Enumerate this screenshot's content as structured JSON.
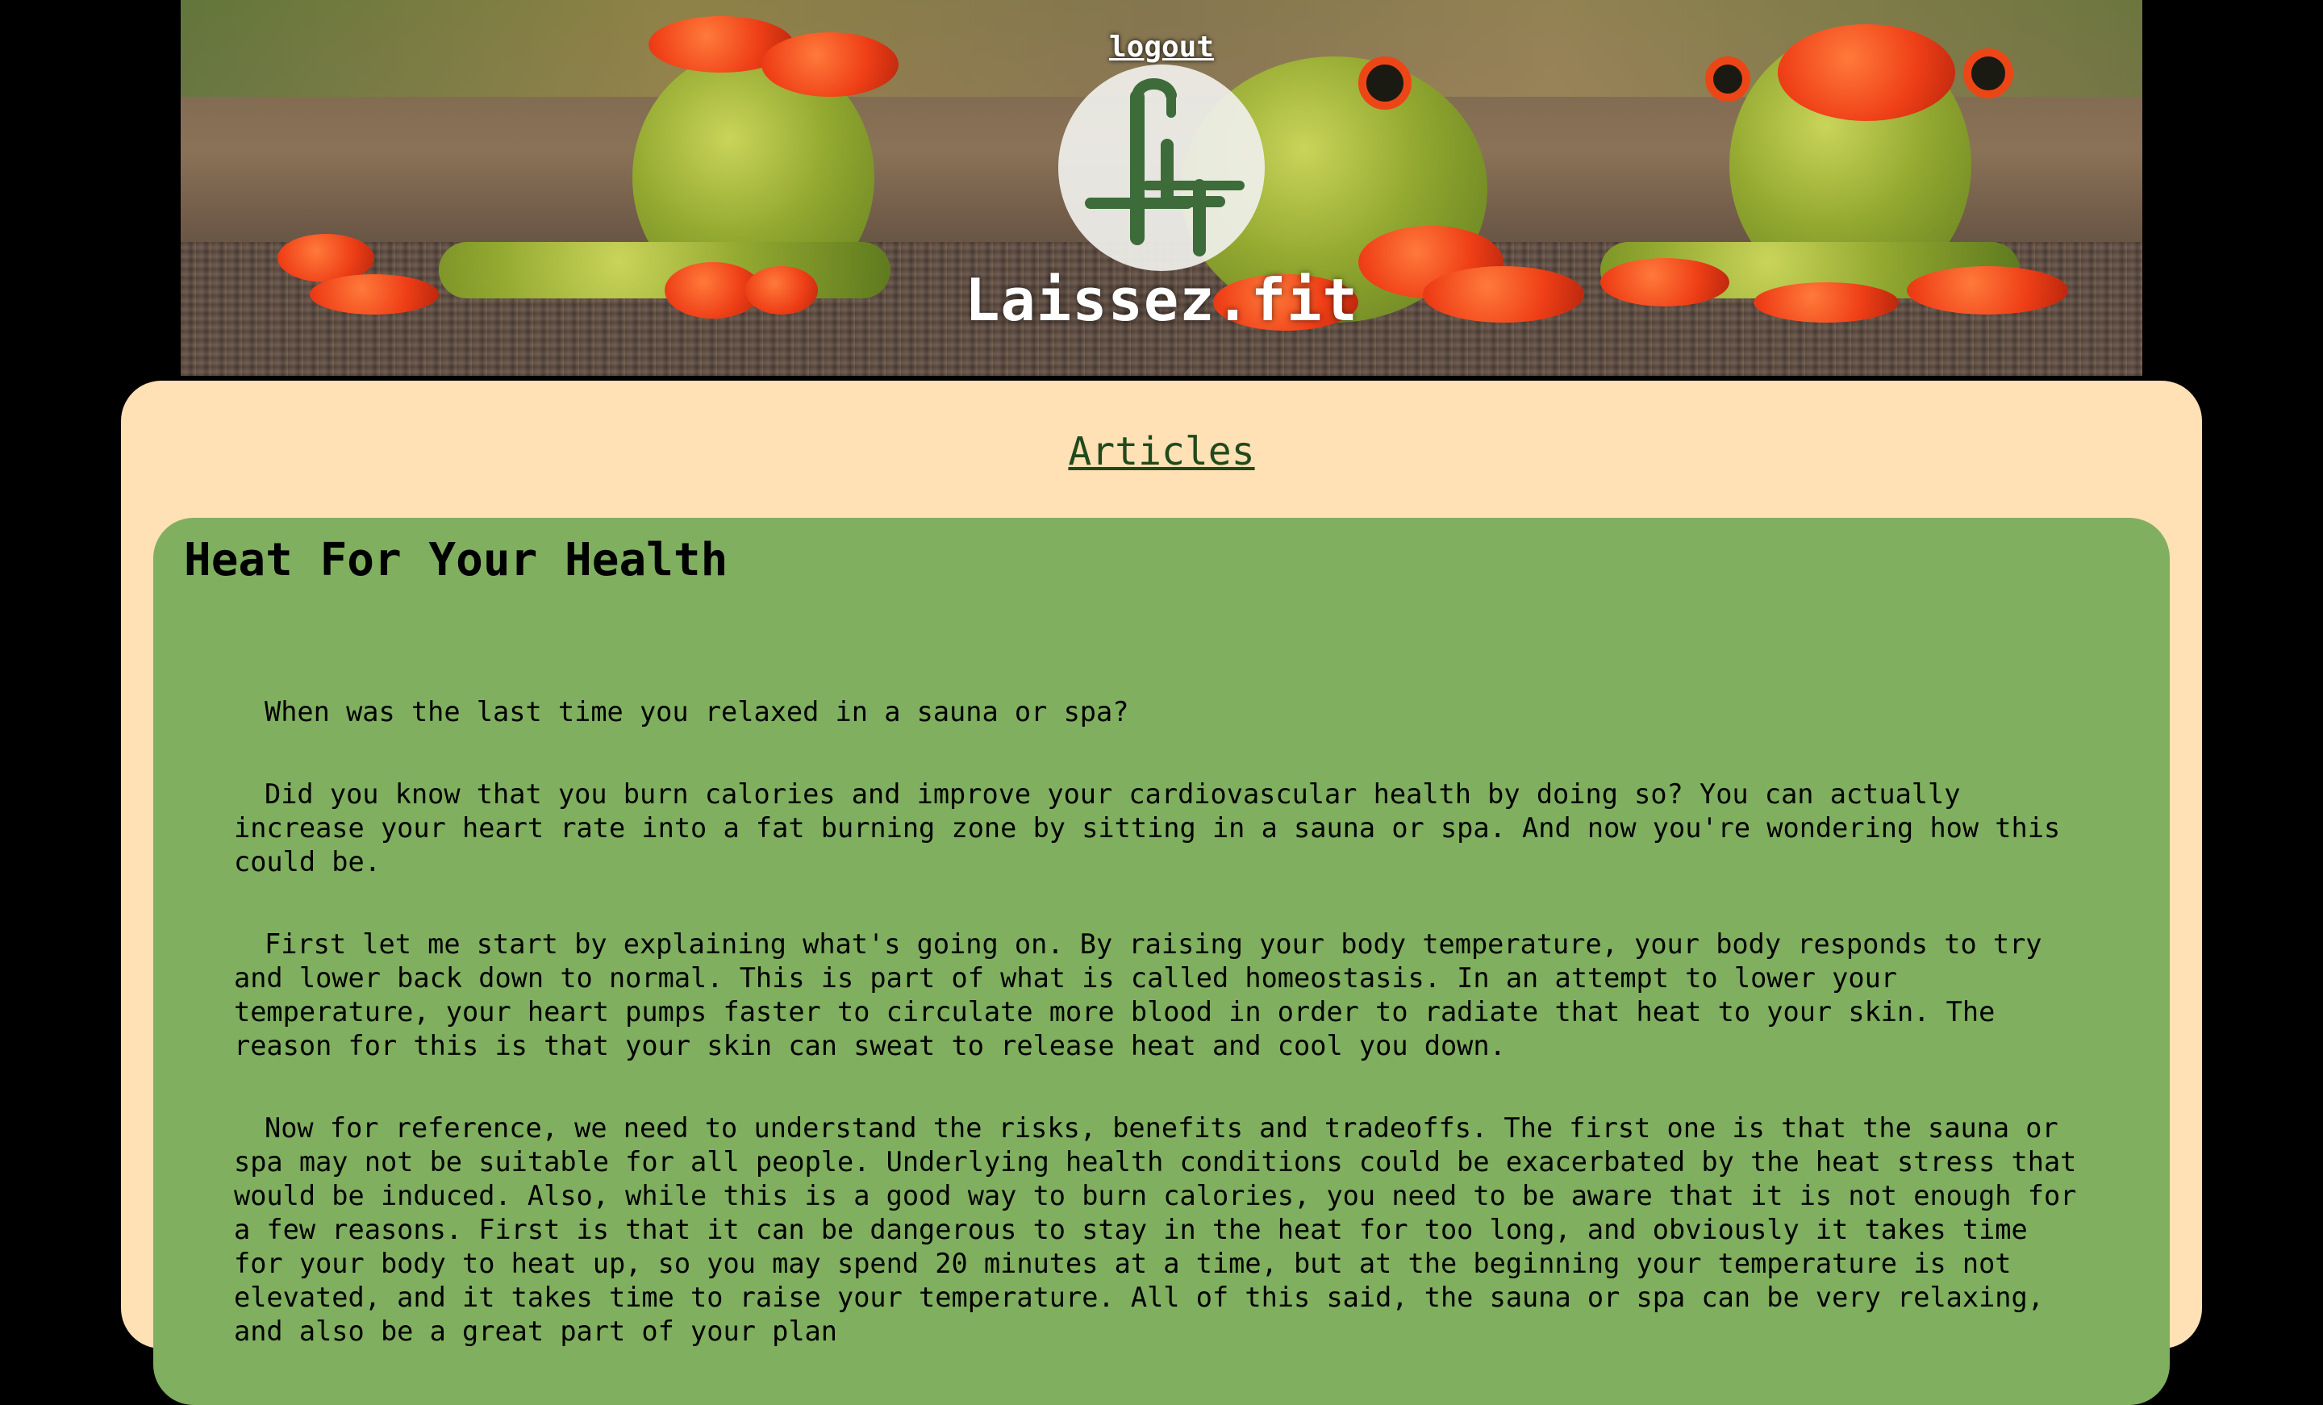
{
  "header": {
    "logout_label": "logout",
    "site_title": "Laissez.fit",
    "logo_icon": "lt-monogram-logo"
  },
  "nav": {
    "articles_label": "Articles"
  },
  "article": {
    "title": "Heat For Your Health",
    "paragraphs": [
      "When was the last time you relaxed in a sauna or spa?",
      "Did you know that you burn calories and improve your cardiovascular health by doing so? You can actually increase your heart rate into a fat burning zone by sitting in a sauna or spa. And now you're wondering how this could be.",
      "First let me start by explaining what's going on. By raising your body temperature, your body responds to try and lower back down to normal. This is part of what is called homeostasis. In an attempt to lower your temperature, your heart pumps faster to circulate more blood in order to radiate that heat to your skin. The reason for this is that your skin can sweat to release heat and cool you down.",
      "Now for reference, we need to understand the risks, benefits and tradeoffs. The first one is that the sauna or spa may not be suitable for all people. Underlying health conditions could be exacerbated by the heat stress that would be induced. Also, while this is a good way to burn calories, you need to be aware that it is not enough for a few reasons. First is that it can be dangerous to stay in the heat for too long, and obviously it takes time for your body to heat up, so you may spend 20 minutes at a time, but at the beginning your temperature is not elevated, and it takes time to raise your temperature. All of this said, the sauna or spa can be very relaxing, and also be a great part of your plan"
    ]
  },
  "colors": {
    "page_bg": "#000000",
    "panel_bg": "#ffe1b5",
    "article_bg": "#80af5f",
    "link_color": "#1f4a1c",
    "logo_green": "#3d6b3a"
  }
}
